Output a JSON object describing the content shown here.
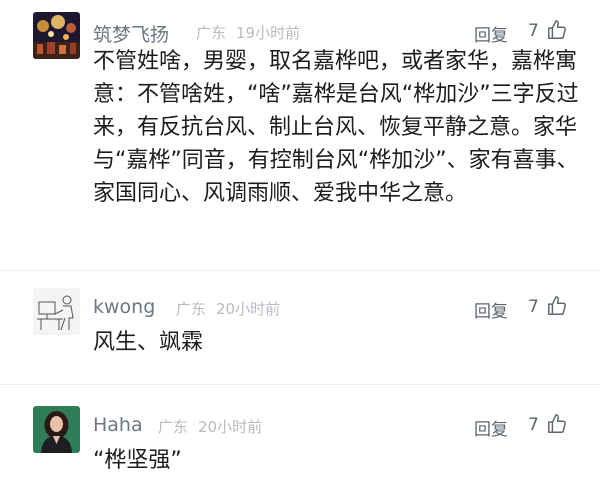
{
  "comments": [
    {
      "username": "筑梦飞扬",
      "location": "广东",
      "time": "19小时前",
      "reply_label": "回复",
      "likes": "7",
      "text": "不管姓啥，男婴，取名嘉桦吧，或者家华，嘉桦寓意：不管啥姓，“啥”嘉桦是台风“桦加沙”三字反过来，有反抗台风、制止台风、恢复平静之意。家华与“嘉桦”同音，有控制台风“桦加沙”、家有喜事、家国同心、风调雨顺、爱我中华之意。"
    },
    {
      "username": "kwong",
      "location": "广东",
      "time": "20小时前",
      "reply_label": "回复",
      "likes": "7",
      "text": "风生、飒霖"
    },
    {
      "username": "Haha",
      "location": "广东",
      "time": "20小时前",
      "reply_label": "回复",
      "likes": "7",
      "text": "“桦坚强”"
    }
  ],
  "colors": {
    "username": "#6b7683",
    "meta": "#b7bcc2",
    "action": "#5c6570",
    "text": "#1c1c1c"
  },
  "icons": [
    "thumbs-up-icon"
  ]
}
